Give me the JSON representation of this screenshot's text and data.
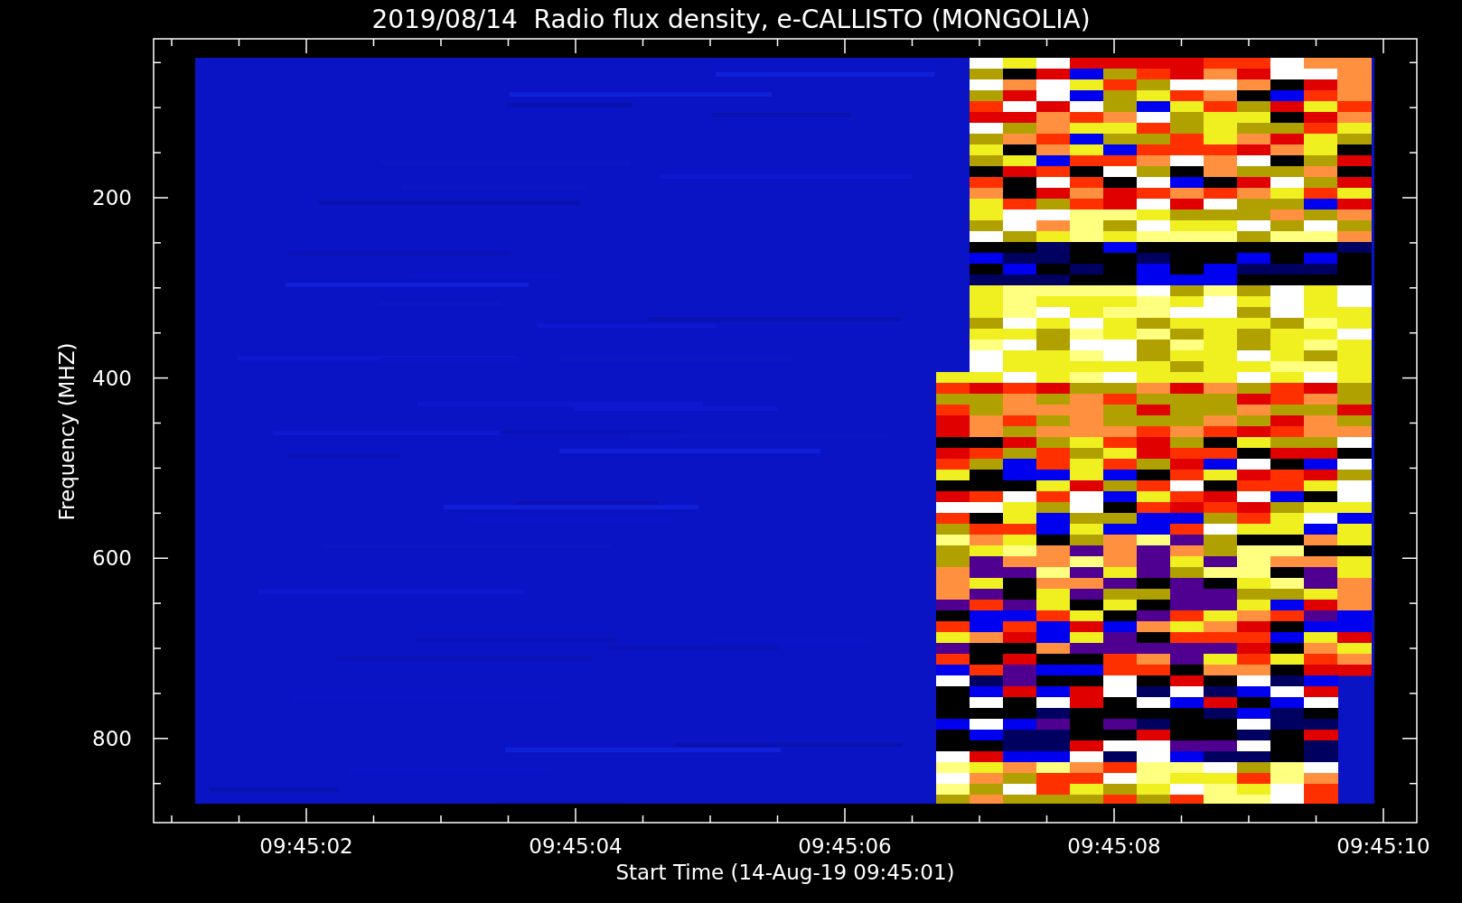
{
  "title": "2019/08/14  Radio flux density, e-CALLISTO (MONGOLIA)",
  "y_axis": {
    "label": "Frequency (MHZ)",
    "ticks": [
      "200",
      "400",
      "600",
      "800"
    ]
  },
  "x_axis": {
    "label": "Start Time (14-Aug-19 09:45:01)",
    "ticks": [
      "09:45:02",
      "09:45:04",
      "09:45:06",
      "09:45:08",
      "09:45:10"
    ]
  }
}
